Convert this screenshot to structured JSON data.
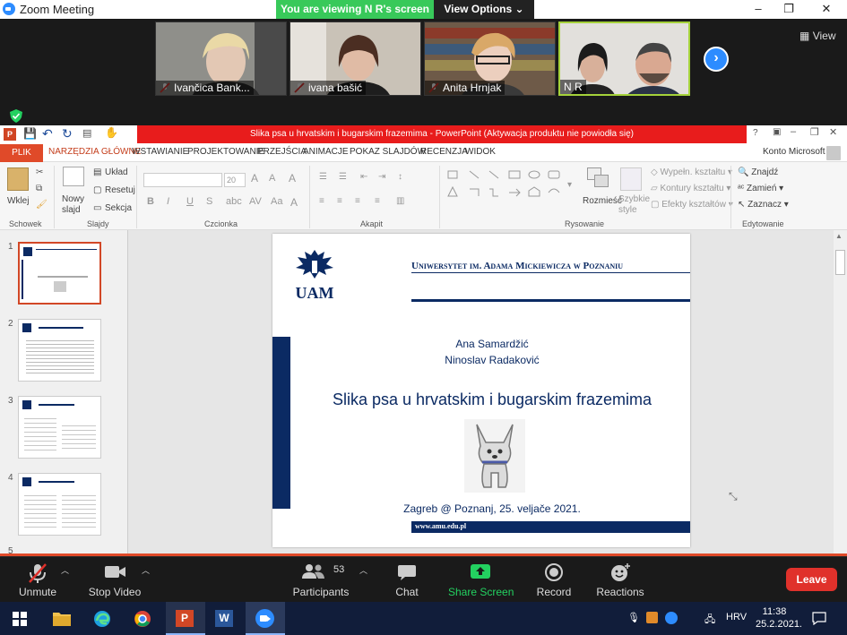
{
  "window": {
    "title": "Zoom Meeting",
    "controls": [
      "–",
      "❐",
      "✕"
    ]
  },
  "viewing_bar": {
    "viewing": "You are viewing N R's screen",
    "options": "View Options"
  },
  "gallery": {
    "participants": [
      {
        "name": "Ivančica Bank...",
        "muted": true,
        "bg": "#8a8a86"
      },
      {
        "name": "ivana bašić",
        "muted": true,
        "bg": "#b9b2a8"
      },
      {
        "name": "Anita Hrnjak",
        "muted": true,
        "bg": "#6e5a48"
      },
      {
        "name": "N R",
        "muted": false,
        "bg": "#d9d7d2"
      }
    ],
    "view_label": "View"
  },
  "ppt": {
    "title": "Slika psa u hrvatskim i bugarskim frazemima  -  PowerPoint (Aktywacja produktu nie powiodła się)",
    "account": "Konto Microsoft",
    "tabs": [
      "PLIK",
      "NARZĘDZIA GŁÓWNE",
      "WSTAWIANIE",
      "PROJEKTOWANIE",
      "PRZEJŚCIA",
      "ANIMACJE",
      "POKAZ SLAJDÓW",
      "RECENZJA",
      "WIDOK"
    ],
    "ribbon": {
      "paste": "Wklej",
      "new_slide": "Nowy slajd",
      "layout": "Układ",
      "reset": "Resetuj",
      "section": "Sekcja",
      "font_size": "20",
      "fill": "Wypełn. kształtu",
      "outline": "Kontury kształtu",
      "effects": "Efekty kształtów",
      "arrange": "Rozmieść",
      "styles": "Szybkie style",
      "find": "Znajdź",
      "replace": "Zamień",
      "select": "Zaznacz",
      "groups": {
        "clipboard": "Schowek",
        "slides": "Slajdy",
        "font": "Czcionka",
        "paragraph": "Akapit",
        "drawing": "Rysowanie",
        "editing": "Edytowanie"
      }
    },
    "thumbnails": [
      "1",
      "2",
      "3",
      "4",
      "5"
    ],
    "slide": {
      "university": "Uniwersytet im. Adama Mickiewicza w Poznaniu",
      "logo_text": "UAM",
      "author1": "Ana Samardžić",
      "author2": "Ninoslav Radaković",
      "title": "Slika psa u hrvatskim i bugarskim frazemima",
      "footer": "Zagreb @ Poznanj, 25. veljače 2021.",
      "url": "www.amu.edu.pl"
    }
  },
  "toolbar": {
    "unmute": "Unmute",
    "stop_video": "Stop Video",
    "participants": "Participants",
    "participant_count": "53",
    "chat": "Chat",
    "share": "Share Screen",
    "record": "Record",
    "reactions": "Reactions",
    "leave": "Leave"
  },
  "taskbar": {
    "lang": "HRV",
    "time": "11:38",
    "date": "25.2.2021."
  },
  "colors": {
    "zoom_blue": "#2d8cff",
    "green": "#38c95a",
    "ppt_red": "#e81c1c",
    "uam_navy": "#0b2a63",
    "leave_red": "#e0312b"
  }
}
